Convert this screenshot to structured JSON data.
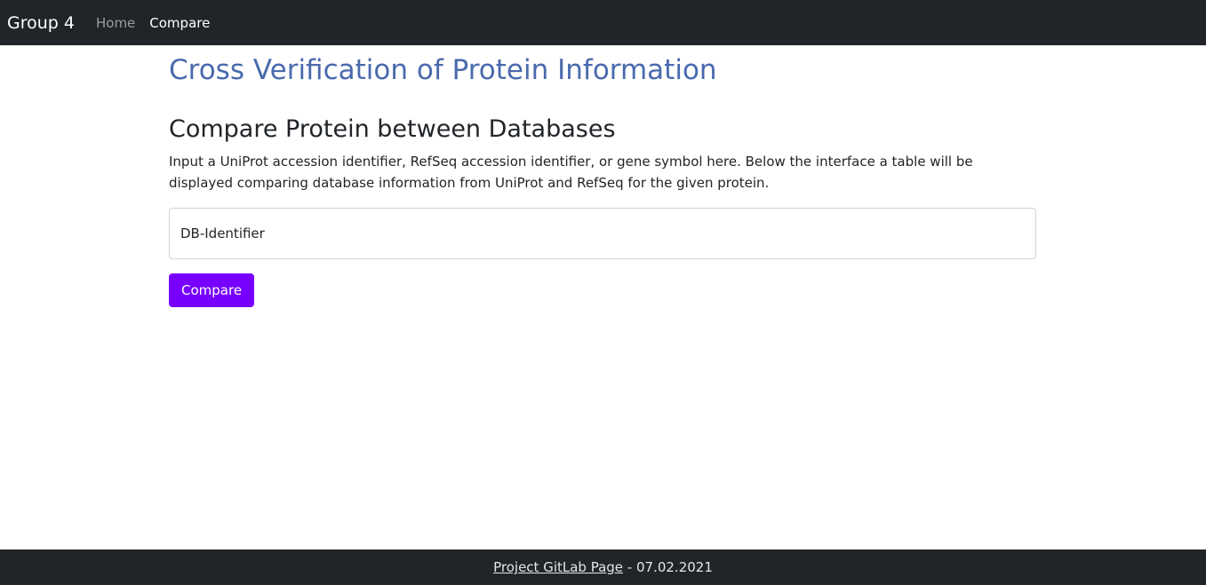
{
  "navbar": {
    "brand": "Group 4",
    "links": [
      {
        "label": "Home",
        "active": false
      },
      {
        "label": "Compare",
        "active": true
      }
    ]
  },
  "main": {
    "site_title": "Cross Verification of Protein Information",
    "section_title": "Compare Protein between Databases",
    "description": "Input a UniProt accession identifier, RefSeq accession identifier, or gene symbol here. Below the interface a table will be displayed comparing database information from UniProt and RefSeq for the given protein.",
    "input": {
      "placeholder": "DB-Identifier",
      "value": ""
    },
    "compare_button": "Compare"
  },
  "footer": {
    "link_text": "Project GitLab Page",
    "separator": " - ",
    "date": "07.02.2021"
  },
  "colors": {
    "navbar_bg": "#212529",
    "title": "#4a6aae",
    "button_bg": "#7700ff"
  }
}
